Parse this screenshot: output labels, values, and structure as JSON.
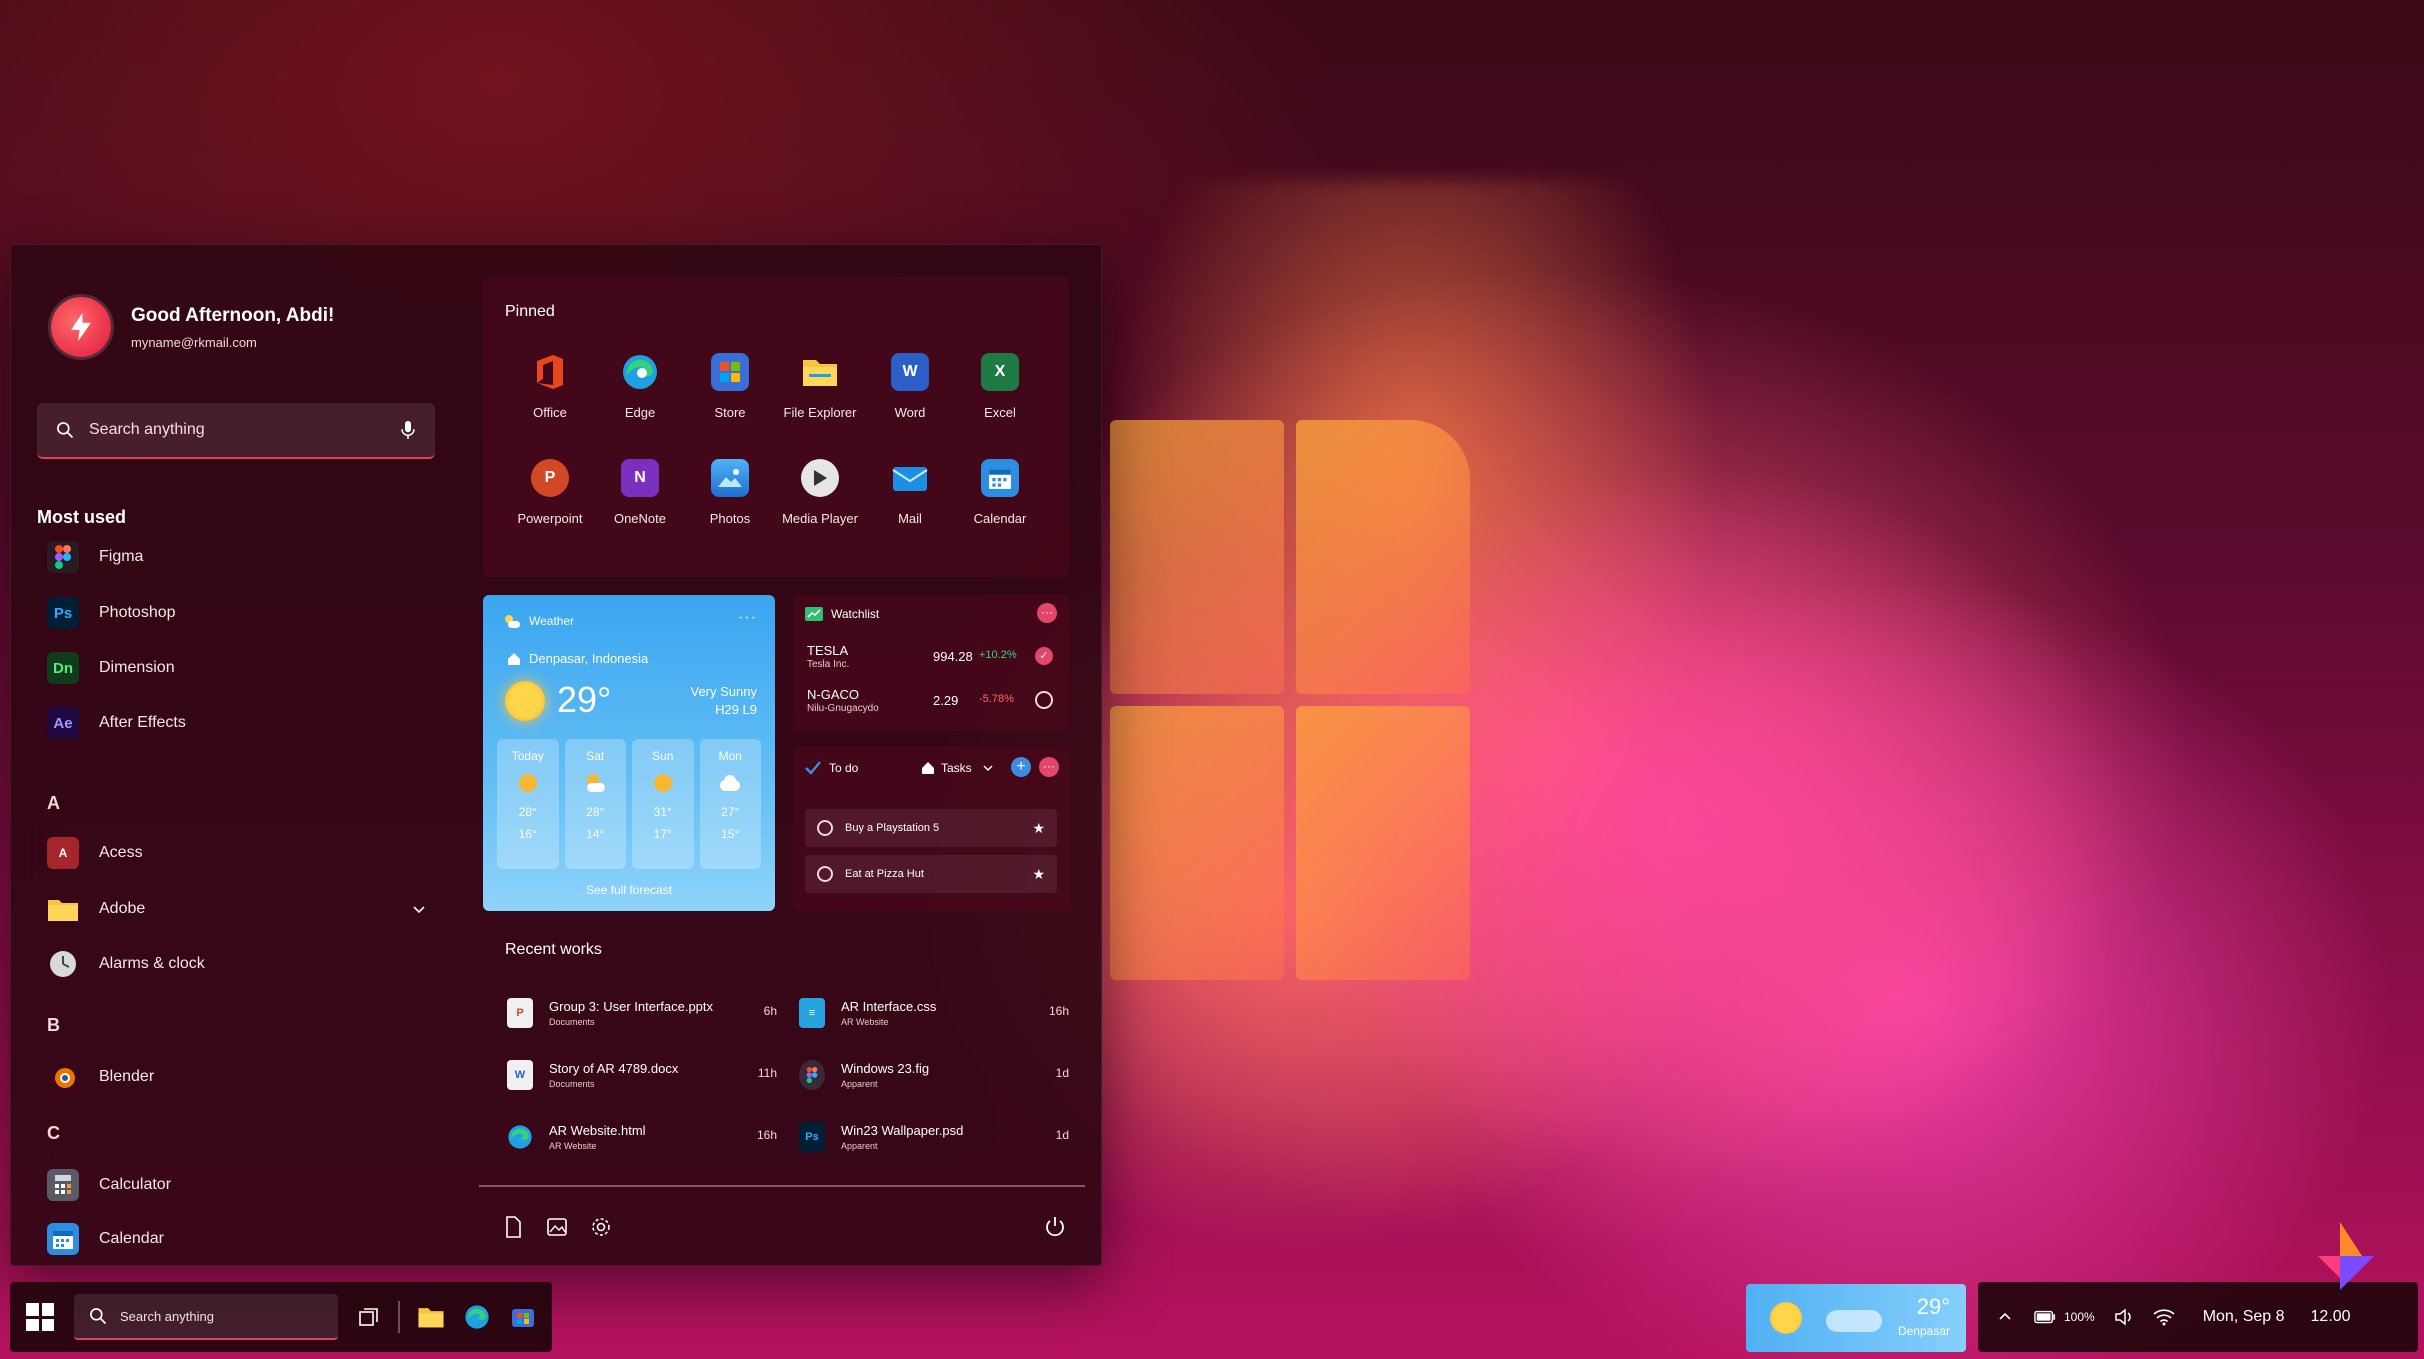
{
  "colors": {
    "accent": "#e04060",
    "weather_blue": "#3aa6f0",
    "positive": "#3ed17a",
    "negative": "#ff6a6a"
  },
  "user": {
    "greeting": "Good Afternoon, Abdi!",
    "email": "myname@rkmail.com"
  },
  "search": {
    "placeholder": "Search anything",
    "icon": "search-icon",
    "mic_icon": "microphone-icon"
  },
  "most_used": {
    "title": "Most used",
    "items": [
      {
        "label": "Figma",
        "icon": "figma-icon",
        "abbr": "",
        "color": "#1e1e1e"
      },
      {
        "label": "Photoshop",
        "icon": "photoshop-icon",
        "abbr": "Ps",
        "color": "#001e36"
      },
      {
        "label": "Dimension",
        "icon": "dimension-icon",
        "abbr": "Dn",
        "color": "#0f3b1a"
      },
      {
        "label": "After Effects",
        "icon": "after-effects-icon",
        "abbr": "Ae",
        "color": "#1f0740"
      }
    ]
  },
  "app_list": {
    "sections": [
      {
        "letter": "A",
        "items": [
          {
            "label": "Acess",
            "icon": "access-icon"
          },
          {
            "label": "Adobe",
            "icon": "folder-icon",
            "expandable": true
          },
          {
            "label": "Alarms & clock",
            "icon": "clock-icon"
          }
        ]
      },
      {
        "letter": "B",
        "items": [
          {
            "label": "Blender",
            "icon": "blender-icon"
          }
        ]
      },
      {
        "letter": "C",
        "items": [
          {
            "label": "Calculator",
            "icon": "calculator-icon"
          },
          {
            "label": "Calendar",
            "icon": "calendar-icon"
          }
        ]
      }
    ]
  },
  "pinned": {
    "title": "Pinned",
    "apps": [
      {
        "label": "Office",
        "icon": "office-icon"
      },
      {
        "label": "Edge",
        "icon": "edge-icon"
      },
      {
        "label": "Store",
        "icon": "store-icon"
      },
      {
        "label": "File Explorer",
        "icon": "file-explorer-icon"
      },
      {
        "label": "Word",
        "icon": "word-icon"
      },
      {
        "label": "Excel",
        "icon": "excel-icon"
      },
      {
        "label": "Powerpoint",
        "icon": "powerpoint-icon"
      },
      {
        "label": "OneNote",
        "icon": "onenote-icon"
      },
      {
        "label": "Photos",
        "icon": "photos-icon"
      },
      {
        "label": "Media Player",
        "icon": "media-player-icon"
      },
      {
        "label": "Mail",
        "icon": "mail-icon"
      },
      {
        "label": "Calendar",
        "icon": "calendar-icon"
      }
    ]
  },
  "weather": {
    "title": "Weather",
    "location": "Denpasar, Indonesia",
    "temp": "29°",
    "condition": "Very Sunny",
    "hilo": "H29 L9",
    "forecast": [
      {
        "day": "Today",
        "icon": "sun-icon",
        "high": "28°",
        "low": "16°"
      },
      {
        "day": "Sat",
        "icon": "partly-cloudy-icon",
        "high": "28°",
        "low": "14°"
      },
      {
        "day": "Sun",
        "icon": "sun-icon",
        "high": "31°",
        "low": "17°"
      },
      {
        "day": "Mon",
        "icon": "cloud-icon",
        "high": "27°",
        "low": "15°"
      }
    ],
    "see_full": "See full forecast"
  },
  "watchlist": {
    "title": "Watchlist",
    "stocks": [
      {
        "name": "TESLA",
        "sub": "Tesla Inc.",
        "value": "994.28",
        "change": "+10.2%",
        "direction": "up"
      },
      {
        "name": "N-GACO",
        "sub": "Nilu-Gnugacydo",
        "value": "2.29",
        "change": "-5.78%",
        "direction": "down"
      }
    ]
  },
  "todo": {
    "title": "To do",
    "list": "Tasks",
    "tasks": [
      {
        "label": "Buy a Playstation 5"
      },
      {
        "label": "Eat at Pizza Hut"
      }
    ]
  },
  "recent": {
    "title": "Recent works",
    "items": [
      {
        "name": "Group 3: User Interface.pptx",
        "sub": "Documents",
        "time": "6h",
        "icon": "powerpoint-file-icon"
      },
      {
        "name": "AR Interface.css",
        "sub": "AR Website",
        "time": "16h",
        "icon": "css-file-icon"
      },
      {
        "name": "Story of AR 4789.docx",
        "sub": "Documents",
        "time": "11h",
        "icon": "word-file-icon"
      },
      {
        "name": "Windows 23.fig",
        "sub": "Apparent",
        "time": "1d",
        "icon": "figma-file-icon"
      },
      {
        "name": "AR Website.html",
        "sub": "AR Website",
        "time": "16h",
        "icon": "edge-file-icon"
      },
      {
        "name": "Win23 Wallpaper.psd",
        "sub": "Apparent",
        "time": "1d",
        "icon": "photoshop-file-icon"
      }
    ]
  },
  "taskbar": {
    "search_placeholder": "Search anything",
    "weather_temp": "29°",
    "weather_city": "Denpasar",
    "battery": "100%",
    "date": "Mon, Sep 8",
    "time": "12.00"
  }
}
